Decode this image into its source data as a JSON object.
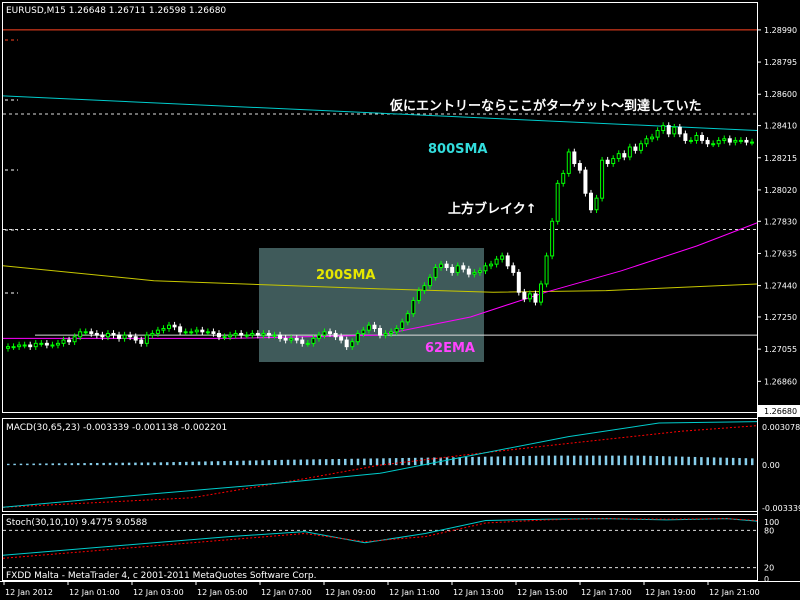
{
  "main_header": "EURUSD,M15  1.26648 1.26711 1.26598 1.26680",
  "macd_header": "MACD(30,65,23) -0.003339 -0.001138 -0.002201",
  "stoch_header": "Stoch(30,10,10) 9.4775 9.0588",
  "copyright": "FXDD Malta - MetaTrader 4, c 2001-2011 MetaQuotes Software Corp.",
  "colors": {
    "background": "#000000",
    "frame": "#ffffff",
    "grid": "#ffffff",
    "bull": "#00ff00",
    "bear": "#ffffff",
    "sma800": "#00cccc",
    "sma200": "#c8c800",
    "ema62": "#ff00ff",
    "macd_hist": "#87ceeb",
    "macd_signal": "#ff0000",
    "stoch_main": "#00cccc",
    "stoch_signal": "#ff0000",
    "top_line": "#ff4422",
    "box": "#4a6a6a"
  },
  "annotations": {
    "target": "仮にエントリーならここがターゲット～到達していた",
    "sma800": "800SMA",
    "breakout": "上方ブレイク↑",
    "sma200": "200SMA",
    "ema62": "62EMA"
  },
  "chart_data": [
    {
      "type": "candlestick",
      "symbol": "EURUSD",
      "timeframe": "M15",
      "ylim": [
        1.2668,
        1.2905
      ],
      "yticks": [
        "1.28990",
        "1.28795",
        "1.28600",
        "1.28410",
        "1.28215",
        "1.28020",
        "1.27830",
        "1.27635",
        "1.27440",
        "1.27250",
        "1.27055",
        "1.26860",
        "1.26680"
      ],
      "xticks": [
        "12 Jan 2012",
        "12 Jan 01:00",
        "12 Jan 03:00",
        "12 Jan 05:00",
        "12 Jan 07:00",
        "12 Jan 09:00",
        "12 Jan 11:00",
        "12 Jan 13:00",
        "12 Jan 15:00",
        "12 Jan 17:00",
        "12 Jan 19:00",
        "12 Jan 21:00"
      ],
      "horizontal_levels": [
        1.2899,
        1.2848,
        1.2778,
        1.2714
      ],
      "close": [
        1.2707,
        1.2707,
        1.2708,
        1.2708,
        1.2707,
        1.2709,
        1.2709,
        1.2708,
        1.2708,
        1.2709,
        1.2711,
        1.271,
        1.2713,
        1.2716,
        1.2716,
        1.2715,
        1.2714,
        1.2713,
        1.2715,
        1.2714,
        1.2712,
        1.2714,
        1.2713,
        1.2711,
        1.2709,
        1.2714,
        1.2715,
        1.2717,
        1.2718,
        1.272,
        1.2719,
        1.2716,
        1.2716,
        1.2716,
        1.2717,
        1.2716,
        1.2716,
        1.2715,
        1.2713,
        1.2713,
        1.2714,
        1.2715,
        1.2714,
        1.2714,
        1.2715,
        1.2714,
        1.2715,
        1.2714,
        1.2714,
        1.2712,
        1.2711,
        1.2712,
        1.2711,
        1.2709,
        1.2709,
        1.2712,
        1.2714,
        1.2716,
        1.2715,
        1.2713,
        1.2711,
        1.2707,
        1.271,
        1.2715,
        1.2717,
        1.272,
        1.2718,
        1.2714,
        1.2715,
        1.2716,
        1.2718,
        1.2722,
        1.2727,
        1.2735,
        1.2741,
        1.2744,
        1.2749,
        1.2755,
        1.2757,
        1.2755,
        1.2752,
        1.2756,
        1.2754,
        1.2751,
        1.2752,
        1.2753,
        1.2756,
        1.2757,
        1.276,
        1.2762,
        1.2756,
        1.2752,
        1.274,
        1.2736,
        1.2739,
        1.2734,
        1.2745,
        1.2762,
        1.2783,
        1.2806,
        1.2812,
        1.2825,
        1.2818,
        1.2814,
        1.28,
        1.279,
        1.2797,
        1.282,
        1.2818,
        1.2821,
        1.2824,
        1.2822,
        1.2828,
        1.2826,
        1.283,
        1.2833,
        1.2834,
        1.2838,
        1.2841,
        1.2836,
        1.284,
        1.2836,
        1.2832,
        1.2832,
        1.2835,
        1.2832,
        1.283,
        1.283,
        1.2832,
        1.2833,
        1.2831,
        1.2832,
        1.2832,
        1.2831,
        1.2831
      ],
      "series": [
        {
          "name": "800SMA",
          "x_frac": [
            0,
            1
          ],
          "values": [
            1.2859,
            1.2838
          ]
        },
        {
          "name": "200SMA",
          "x_frac": [
            0,
            0.2,
            0.5,
            0.65,
            0.8,
            1
          ],
          "values": [
            1.2756,
            1.2747,
            1.2742,
            1.274,
            1.2741,
            1.2745
          ]
        },
        {
          "name": "62EMA",
          "x_frac": [
            0,
            0.3,
            0.5,
            0.62,
            0.72,
            0.82,
            0.92,
            1
          ],
          "values": [
            1.2712,
            1.2712,
            1.2714,
            1.2725,
            1.274,
            1.2753,
            1.2768,
            1.2782
          ]
        }
      ]
    },
    {
      "type": "macd",
      "ylim": [
        -0.0033,
        0.0031
      ],
      "yticks": [
        "0.003078",
        "0.00",
        "-0.003339"
      ],
      "series": [
        {
          "name": "histogram",
          "x_frac": [
            0,
            0.2,
            0.38,
            0.5,
            0.62,
            0.72,
            0.85,
            1
          ],
          "values": [
            0.0001,
            0.0002,
            0.0004,
            0.0005,
            0.0006,
            0.0007,
            0.0007,
            0.0005
          ]
        },
        {
          "name": "signal",
          "x_frac": [
            0,
            0.25,
            0.4,
            0.5,
            0.62,
            0.75,
            0.9,
            1
          ],
          "values": [
            -0.0031,
            -0.0024,
            -0.001,
            0.0,
            0.0008,
            0.0016,
            0.0025,
            0.0029
          ]
        },
        {
          "name": "main",
          "x_frac": [
            0,
            0.2,
            0.35,
            0.5,
            0.62,
            0.75,
            0.87,
            1
          ],
          "values": [
            -0.0031,
            -0.0021,
            -0.0014,
            -0.0006,
            0.0007,
            0.0021,
            0.0031,
            0.0032
          ]
        }
      ]
    },
    {
      "type": "stochastic",
      "ylim": [
        0,
        100
      ],
      "yticks": [
        "100",
        "80",
        "20",
        "0"
      ],
      "levels": [
        80,
        20
      ],
      "series": [
        {
          "name": "main",
          "x_frac": [
            0,
            0.1,
            0.2,
            0.3,
            0.4,
            0.48,
            0.56,
            0.64,
            0.72,
            0.8,
            0.88,
            0.96,
            1
          ],
          "values": [
            40,
            50,
            60,
            70,
            78,
            60,
            75,
            96,
            98,
            99,
            97,
            99,
            95
          ]
        },
        {
          "name": "signal",
          "x_frac": [
            0,
            0.1,
            0.2,
            0.3,
            0.4,
            0.48,
            0.56,
            0.64,
            0.72,
            0.8,
            0.88,
            0.96,
            1
          ],
          "values": [
            35,
            45,
            55,
            65,
            75,
            62,
            70,
            92,
            97,
            99,
            98,
            99,
            96
          ]
        }
      ]
    }
  ]
}
